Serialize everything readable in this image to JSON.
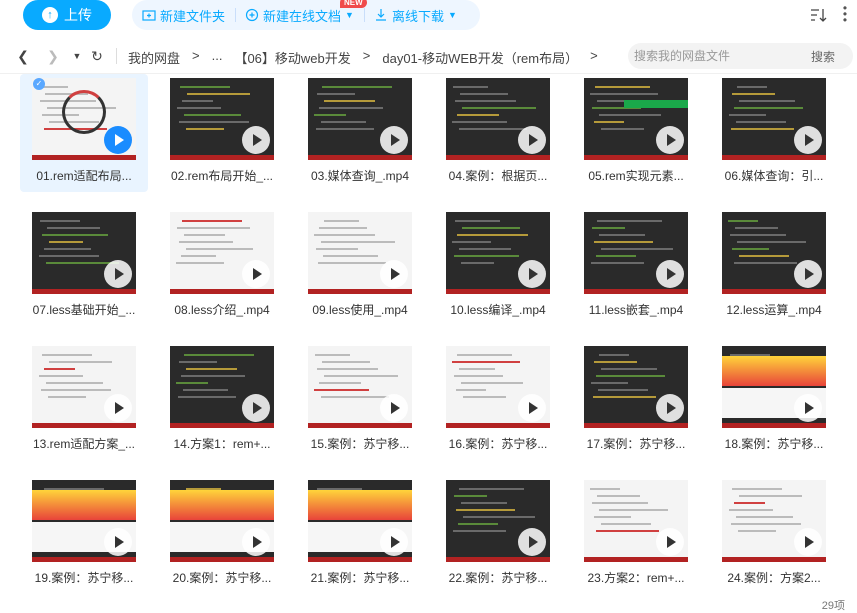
{
  "toolbar": {
    "upload_label": "上传",
    "new_folder_label": "新建文件夹",
    "new_online_doc_label": "新建在线文档",
    "new_badge": "NEW",
    "offline_download_label": "离线下载"
  },
  "nav": {
    "crumbs": [
      "我的网盘",
      ">",
      "...",
      "【06】移动web开发",
      ">",
      "day01-移动WEB开发（rem布局）",
      ">"
    ],
    "search_placeholder": "搜索我的网盘文件",
    "search_button": "搜索"
  },
  "files": [
    {
      "name": "01.rem适配布局...",
      "kind": "title"
    },
    {
      "name": "02.rem布局开始_...",
      "kind": "dark"
    },
    {
      "name": "03.媒体查询_.mp4",
      "kind": "dark"
    },
    {
      "name": "04.案例：根据页...",
      "kind": "dark"
    },
    {
      "name": "05.rem实现元素...",
      "kind": "green"
    },
    {
      "name": "06.媒体查询：引...",
      "kind": "dark"
    },
    {
      "name": "07.less基础开始_...",
      "kind": "dark"
    },
    {
      "name": "08.less介绍_.mp4",
      "kind": "light"
    },
    {
      "name": "09.less使用_.mp4",
      "kind": "light"
    },
    {
      "name": "10.less编译_.mp4",
      "kind": "dark"
    },
    {
      "name": "11.less嵌套_.mp4",
      "kind": "dark"
    },
    {
      "name": "12.less运算_.mp4",
      "kind": "dark"
    },
    {
      "name": "13.rem适配方案_...",
      "kind": "light"
    },
    {
      "name": "14.方案1：rem+...",
      "kind": "dark"
    },
    {
      "name": "15.案例：苏宁移...",
      "kind": "light"
    },
    {
      "name": "16.案例：苏宁移...",
      "kind": "light"
    },
    {
      "name": "17.案例：苏宁移...",
      "kind": "dark"
    },
    {
      "name": "18.案例：苏宁移...",
      "kind": "shop"
    },
    {
      "name": "19.案例：苏宁移...",
      "kind": "shop"
    },
    {
      "name": "20.案例：苏宁移...",
      "kind": "shop"
    },
    {
      "name": "21.案例：苏宁移...",
      "kind": "shop"
    },
    {
      "name": "22.案例：苏宁移...",
      "kind": "dark"
    },
    {
      "name": "23.方案2：rem+...",
      "kind": "light"
    },
    {
      "name": "24.案例：方案2...",
      "kind": "light"
    }
  ],
  "footer": {
    "count": "29项"
  },
  "colors": {
    "accent": "#09aaff",
    "selected_bg": "#e9f4ff",
    "video_bar": "#b22222"
  }
}
